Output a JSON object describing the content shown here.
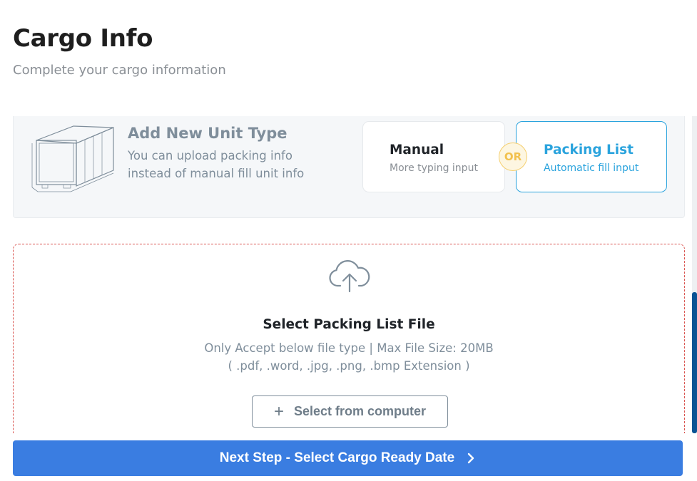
{
  "header": {
    "title": "Cargo Info",
    "subtitle": "Complete your cargo information"
  },
  "unit_type": {
    "title": "Add New Unit Type",
    "description": "You can upload packing info instead of manual fill unit info",
    "illustration_icon": "container-box-icon"
  },
  "options": {
    "manual": {
      "title": "Manual",
      "subtitle": "More typing input"
    },
    "or_label": "OR",
    "packing_list": {
      "title": "Packing List",
      "subtitle": "Automatic fill input",
      "selected": true
    }
  },
  "upload": {
    "icon": "cloud-upload-icon",
    "title": "Select Packing List File",
    "accept_text": "Only Accept below file type | Max File Size: 20MB",
    "extensions_text": "( .pdf, .word, .jpg, .png, .bmp Extension )",
    "select_button": "Select from computer"
  },
  "footer": {
    "next_button": "Next Step - Select Cargo Ready Date"
  },
  "colors": {
    "accent_blue": "#3a7de1",
    "selected_border": "#2aa3dd",
    "or_badge": "#f2c14e",
    "dropzone_border": "#d9534f",
    "scrollbar": "#0b5394"
  }
}
